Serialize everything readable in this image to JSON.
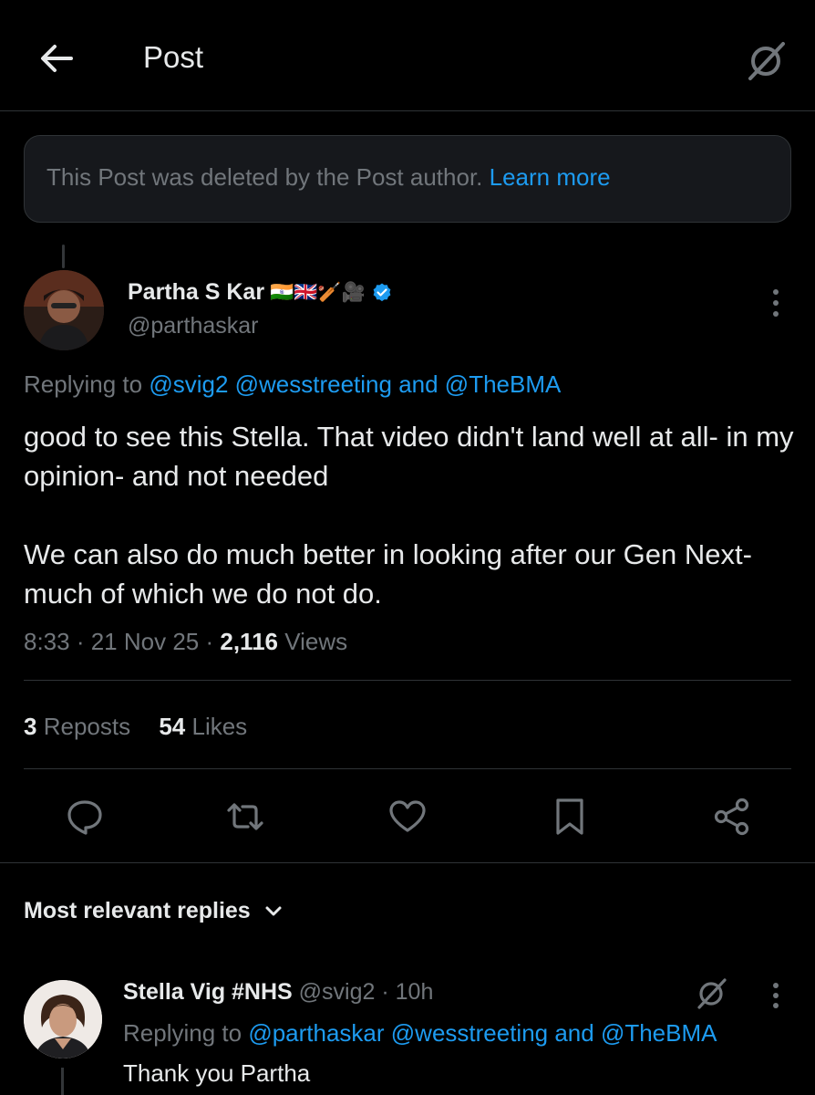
{
  "header": {
    "title": "Post",
    "back_icon": "arrow-left-icon",
    "grok_icon": "grok-icon"
  },
  "notice": {
    "text": "This Post was deleted by the Post author.",
    "link": "Learn more"
  },
  "post": {
    "author_name": "Partha S Kar",
    "author_emoji": "🇮🇳🇬🇧🏏🎥",
    "author_handle": "@parthaskar",
    "replying_prefix": "Replying to",
    "replying_to": "@svig2 @wesstreeting and @TheBMA",
    "body_paragraph_1": "good to see this Stella. That video didn't land well at all- in my opinion- and not needed",
    "body_paragraph_2": "We can also do much better in looking after our Gen Next- much of which we do not do.",
    "time": "8:33",
    "date": "21 Nov 25",
    "views_count": "2,116",
    "views_label": "Views",
    "reposts_count": "3",
    "reposts_label": "Reposts",
    "likes_count": "54",
    "likes_label": "Likes"
  },
  "replies_section": {
    "title": "Most relevant replies"
  },
  "reply": {
    "author_name": "Stella Vig #NHS",
    "author_handle": "@svig2",
    "age": "10h",
    "replying_prefix": "Replying to",
    "replying_to": "@parthaskar @wesstreeting and @TheBMA",
    "text": "Thank you Partha"
  },
  "colors": {
    "background": "#000000",
    "text_primary": "#e7e9ea",
    "text_muted": "#71767b",
    "accent": "#1d9bf0",
    "border": "#2f3336",
    "notice_bg": "#16181c"
  }
}
